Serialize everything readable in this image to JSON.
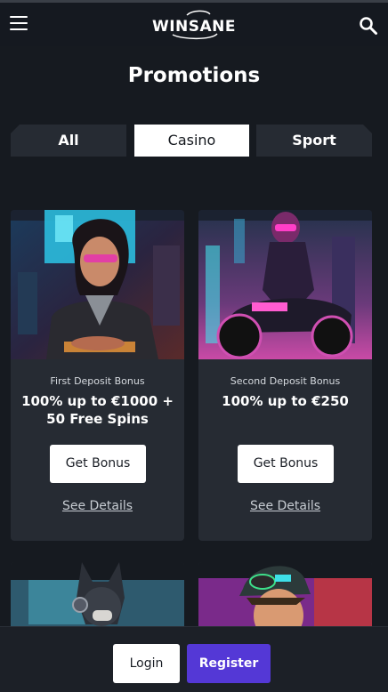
{
  "header": {
    "logo_text": "WINSANE",
    "menu_icon": "hamburger-menu-icon",
    "search_icon": "search-icon"
  },
  "page": {
    "title": "Promotions"
  },
  "tabs": [
    {
      "label": "All",
      "active": false
    },
    {
      "label": "Casino",
      "active": true
    },
    {
      "label": "Sport",
      "active": false
    }
  ],
  "promotions": [
    {
      "subtitle": "First Deposit Bonus",
      "title": "100% up to €1000 + 50 Free Spins",
      "button_label": "Get Bonus",
      "link_label": "See Details",
      "image": "cyberpunk-woman-illustration"
    },
    {
      "subtitle": "Second Deposit Bonus",
      "title": "100% up to €250",
      "button_label": "Get Bonus",
      "link_label": "See Details",
      "image": "motorcycle-rider-illustration"
    },
    {
      "image": "dog-with-headphones-illustration"
    },
    {
      "image": "boy-with-goggles-illustration"
    }
  ],
  "auth": {
    "login_label": "Login",
    "register_label": "Register"
  },
  "colors": {
    "background": "#161a20",
    "card": "#262b33",
    "register": "#5438d6",
    "accent_pink": "#e0359a",
    "accent_cyan": "#3ee0e8"
  }
}
